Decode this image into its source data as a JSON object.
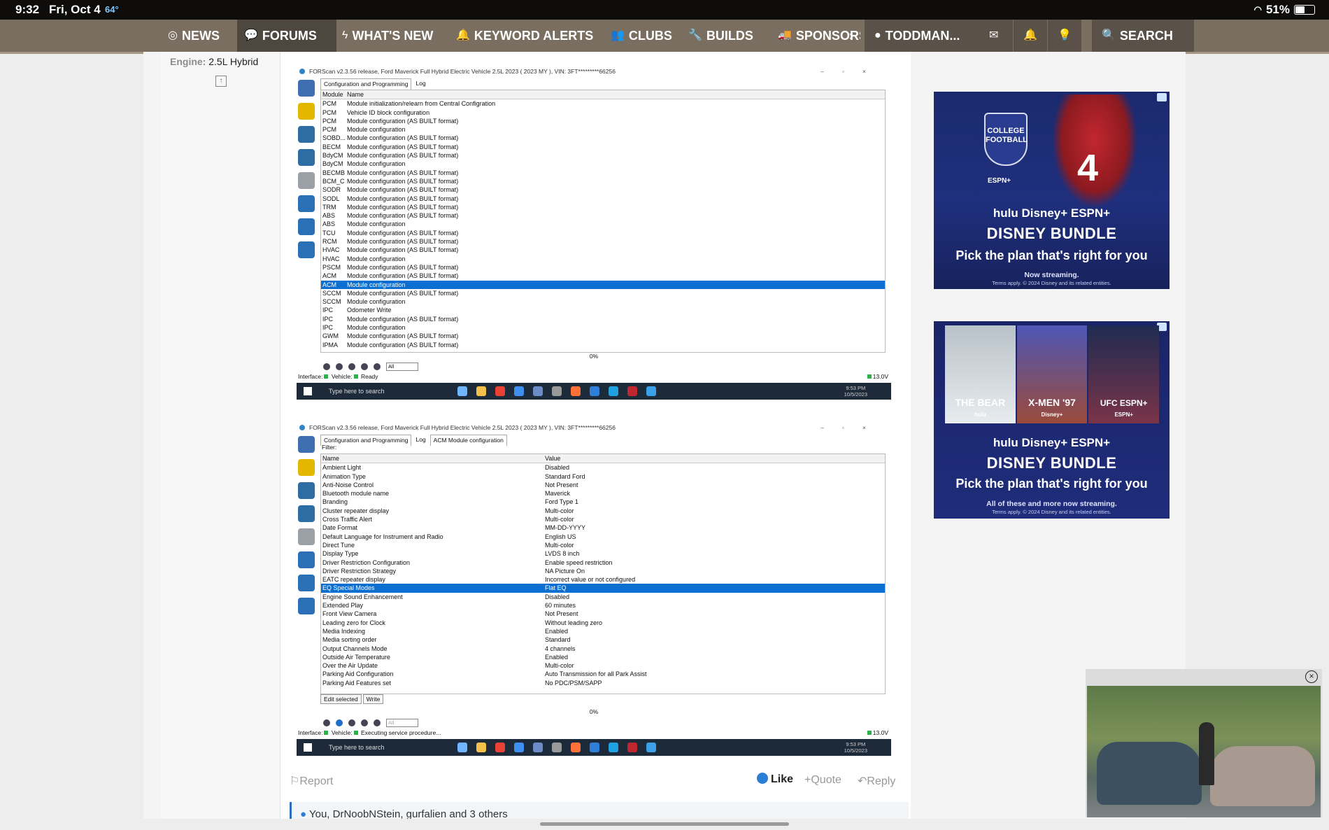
{
  "status": {
    "time": "9:32",
    "date": "Fri, Oct 4",
    "temp": "64°",
    "battery": "51%"
  },
  "nav": {
    "news": "NEWS",
    "forums": "FORUMS",
    "whats_new": "WHAT'S NEW",
    "keyword_alerts": "KEYWORD ALERTS",
    "clubs": "CLUBS",
    "builds": "BUILDS",
    "sponsors": "SPONSORS",
    "user": "TODDMAN...",
    "search": "SEARCH"
  },
  "user_info": {
    "engine_label": "Engine:",
    "engine_value": "2.5L Hybrid"
  },
  "shot1": {
    "title": "FORScan v2.3.56 release, Ford Maverick Full Hybrid Electric Vehicle 2.5L 2023 ( 2023 MY ), VIN: 3FT*********66256",
    "tab1": "Configuration and Programming",
    "tab2": "Log",
    "col_module": "Module",
    "col_name": "Name",
    "rows": [
      [
        "PCM",
        "Module initialization/relearn from Central Configration"
      ],
      [
        "PCM",
        "Vehicle ID block configuration"
      ],
      [
        "PCM",
        "Module configuration (AS BUILT format)"
      ],
      [
        "PCM",
        "Module configuration"
      ],
      [
        "SOBD...",
        "Module configuration (AS BUILT format)"
      ],
      [
        "BECM",
        "Module configuration (AS BUILT format)"
      ],
      [
        "BdyCM",
        "Module configuration (AS BUILT format)"
      ],
      [
        "BdyCM",
        "Module configuration"
      ],
      [
        "BECMB",
        "Module configuration (AS BUILT format)"
      ],
      [
        "BCM_C",
        "Module configuration (AS BUILT format)"
      ],
      [
        "SODR",
        "Module configuration (AS BUILT format)"
      ],
      [
        "SODL",
        "Module configuration (AS BUILT format)"
      ],
      [
        "TRM",
        "Module configuration (AS BUILT format)"
      ],
      [
        "ABS",
        "Module configuration (AS BUILT format)"
      ],
      [
        "ABS",
        "Module configuration"
      ],
      [
        "TCU",
        "Module configuration (AS BUILT format)"
      ],
      [
        "RCM",
        "Module configuration (AS BUILT format)"
      ],
      [
        "HVAC",
        "Module configuration (AS BUILT format)"
      ],
      [
        "HVAC",
        "Module configuration"
      ],
      [
        "PSCM",
        "Module configuration (AS BUILT format)"
      ],
      [
        "ACM",
        "Module configuration (AS BUILT format)"
      ],
      [
        "ACM",
        "Module configuration"
      ],
      [
        "SCCM",
        "Module configuration (AS BUILT format)"
      ],
      [
        "SCCM",
        "Module configuration"
      ],
      [
        "IPC",
        "Odometer Write"
      ],
      [
        "IPC",
        "Module configuration (AS BUILT format)"
      ],
      [
        "IPC",
        "Module configuration"
      ],
      [
        "GWM",
        "Module configuration (AS BUILT format)"
      ],
      [
        "IPMA",
        "Module configuration (AS BUILT format)"
      ]
    ],
    "selected_index": 21,
    "percent": "0%",
    "filter_value": "All",
    "interface_label": "Interface:",
    "vehicle_label": "Vehicle:",
    "state": "Ready",
    "voltage": "13.0V",
    "search_placeholder": "Type here to search",
    "clock_time": "9:53 PM",
    "clock_date": "10/5/2023"
  },
  "shot2": {
    "title": "FORScan v2.3.56 release, Ford Maverick Full Hybrid Electric Vehicle 2.5L 2023 ( 2023 MY ), VIN: 3FT*********66256",
    "tab1": "Configuration and Programming",
    "tab2": "Log",
    "tab3": "ACM Module configuration",
    "filter_label": "Filter:",
    "col_name": "Name",
    "col_value": "Value",
    "rows": [
      [
        "Ambient Light",
        "Disabled"
      ],
      [
        "Animation Type",
        "Standard Ford"
      ],
      [
        "Anti-Noise Control",
        "Not Present"
      ],
      [
        "Bluetooth module name",
        "Maverick"
      ],
      [
        "Branding",
        "Ford Type 1"
      ],
      [
        "Cluster repeater display",
        "Multi-color"
      ],
      [
        "Cross Traffic Alert",
        "Multi-color"
      ],
      [
        "Date Format",
        "MM-DD-YYYY"
      ],
      [
        "Default Language for Instrument and Radio",
        "English US"
      ],
      [
        "Direct Tune",
        "Multi-color"
      ],
      [
        "Display Type",
        "LVDS 8 inch"
      ],
      [
        "Driver Restriction Configuration",
        "Enable speed restriction"
      ],
      [
        "Driver Restriction Strategy",
        "NA Picture On"
      ],
      [
        "EATC repeater display",
        "Incorrect value or not configured"
      ],
      [
        "EQ Special Modes",
        "Flat EQ"
      ],
      [
        "Engine Sound Enhancement",
        "Disabled"
      ],
      [
        "Extended Play",
        "60 minutes"
      ],
      [
        "Front View Camera",
        "Not Present"
      ],
      [
        "Leading zero for Clock",
        "Without leading zero"
      ],
      [
        "Media Indexing",
        "Enabled"
      ],
      [
        "Media sorting order",
        "Standard"
      ],
      [
        "Output Channels Mode",
        "4 channels"
      ],
      [
        "Outside Air Temperature",
        "Enabled"
      ],
      [
        "Over the Air Update",
        "Multi-color"
      ],
      [
        "Parking Aid Configuration",
        "Auto Transmission for all Park Assist"
      ],
      [
        "Parking Aid Features set",
        "No PDC/PSM/SAPP"
      ]
    ],
    "selected_index": 14,
    "edit_selected": "Edit selected",
    "write": "Write",
    "percent": "0%",
    "filter_value": "All",
    "interface_label": "Interface:",
    "vehicle_label": "Vehicle:",
    "state": "Executing service procedure...",
    "voltage": "13.0V",
    "search_placeholder": "Type here to search",
    "clock_time": "9:53 PM",
    "clock_date": "10/5/2023"
  },
  "post_actions": {
    "report": "Report",
    "like": "Like",
    "quote": "Quote",
    "reply": "Reply"
  },
  "reactions": "You, DrNoobNStein, gurfalien and 3 others",
  "ad1": {
    "shield": "COLLEGE FOOTBALL",
    "network": "ESPN+",
    "jersey": "4",
    "brands": "hulu  Disney+  ESPN+",
    "headline": "DISNEY BUNDLE",
    "tagline": "Pick the plan that's right for you",
    "sub": "Now streaming.",
    "fine": "Terms apply. © 2024 Disney and its related entities."
  },
  "ad2": {
    "tile1": "THE BEAR",
    "tile1_sub": "hulu",
    "tile2": "X-MEN '97",
    "tile2_sub": "Disney+",
    "tile3": "UFC ESPN+",
    "tile3_sub": "ESPN+",
    "brands": "hulu  Disney+  ESPN+",
    "headline": "DISNEY BUNDLE",
    "tagline": "Pick the plan that's right for you",
    "sub": "All of these and more now streaming.",
    "fine": "Terms apply. © 2024 Disney and its related entities."
  },
  "colors": {
    "nav": "#7a6e60",
    "selection": "#0a6fd1",
    "ad_bg": "#1f2f7d"
  }
}
